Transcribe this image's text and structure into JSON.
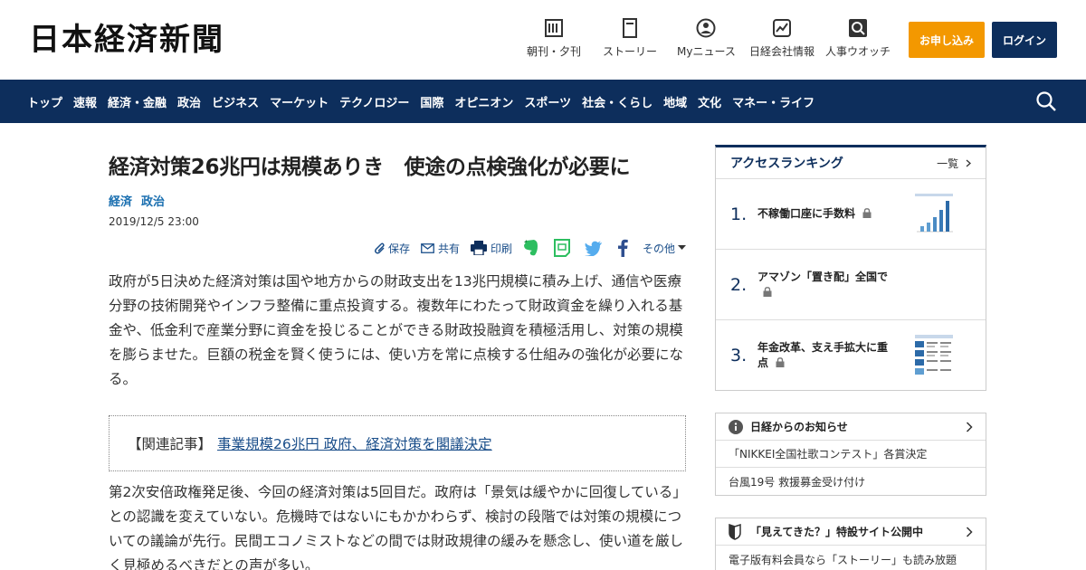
{
  "header": {
    "logo": "日本経済新聞",
    "utils": [
      {
        "label": "朝刊・夕刊",
        "icon": "newspaper-icon"
      },
      {
        "label": "ストーリー",
        "icon": "book-icon"
      },
      {
        "label": "Myニュース",
        "icon": "person-icon"
      },
      {
        "label": "日経会社情報",
        "icon": "chart-icon"
      },
      {
        "label": "人事ウオッチ",
        "icon": "magnifier-icon"
      }
    ],
    "subscribe": "お申し込み",
    "login": "ログイン"
  },
  "nav": {
    "items": [
      "トップ",
      "速報",
      "経済・金融",
      "政治",
      "ビジネス",
      "マーケット",
      "テクノロジー",
      "国際",
      "オピニオン",
      "スポーツ",
      "社会・くらし",
      "地域",
      "文化",
      "マネー・ライフ"
    ]
  },
  "article": {
    "title": "経済対策26兆円は規模ありき　使途の点検強化が必要に",
    "tags": [
      "経済",
      "政治"
    ],
    "date": "2019/12/5 23:00",
    "tools": {
      "save": "保存",
      "share": "共有",
      "print": "印刷",
      "other": "その他"
    },
    "para1": "政府が5日決めた経済対策は国や地方からの財政支出を13兆円規模に積み上げ、通信や医療分野の技術開発やインフラ整備に重点投資する。複数年にわたって財政資金を繰り入れる基金や、低金利で産業分野に資金を投じることができる財政投融資を積極活用し、対策の規模を膨らませた。巨額の税金を賢く使うには、使い方を常に点検する仕組みの強化が必要になる。",
    "related_label": "【関連記事】",
    "related_link": "事業規模26兆円 政府、経済対策を閣議決定",
    "para2": "第2次安倍政権発足後、今回の経済対策は5回目だ。政府は「景気は緩やかに回復している」との認識を変えていない。危機時ではないにもかかわらず、検討の段階では対策の規模についての議論が先行。民間エコノミストなどの間では財政規律の緩みを懸念し、使い道を厳しく見極めるべきだとの声が多い。"
  },
  "ranking": {
    "title": "アクセスランキング",
    "more": "一覧",
    "items": [
      {
        "num": "1.",
        "text": "不稼働口座に手数料"
      },
      {
        "num": "2.",
        "text": "アマゾン「置き配」全国で"
      },
      {
        "num": "3.",
        "text": "年金改革、支え手拡大に重点"
      }
    ]
  },
  "notice": {
    "title": "日経からのお知らせ",
    "items": [
      "「NIKKEI全国社歌コンテスト」各賞決定",
      "台風19号 救援募金受け付け"
    ]
  },
  "notice2": {
    "title": "「見えてきた？」特設サイト公開中",
    "items": [
      "電子版有料会員なら「ストーリー」も読み放題"
    ]
  },
  "colors": {
    "navy": "#0d2e5c",
    "orange": "#f39800",
    "link": "#1a4e8a"
  }
}
